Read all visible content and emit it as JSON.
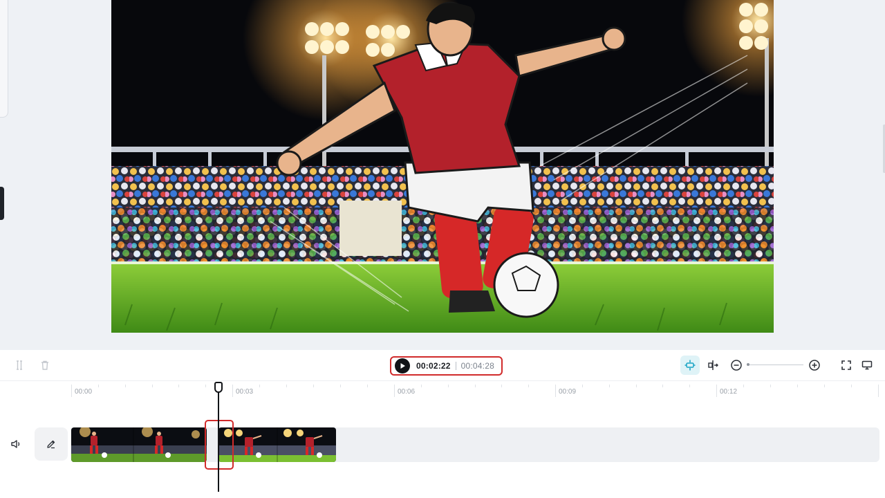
{
  "player": {
    "current_time": "00:02:22",
    "total_time": "00:04:28"
  },
  "toolbar": {
    "left_icons": [
      "split-icon",
      "trash-icon"
    ],
    "right_icons": [
      "auto-snap-icon",
      "split-align-icon",
      "zoom-out-icon",
      "zoom-in-icon",
      "fullscreen-icon",
      "monitor-icon"
    ],
    "zoom_level": 0.0
  },
  "timeline": {
    "ruler_labels": [
      "00:00",
      "00:03",
      "00:06",
      "00:09",
      "00:12"
    ],
    "playhead_time": "00:02:22",
    "track": {
      "icons": [
        "speaker-icon",
        "pencil-icon"
      ],
      "clips": [
        {
          "name": "clip-1"
        },
        {
          "name": "clip-2"
        }
      ]
    }
  },
  "colors": {
    "accent_highlight": "#d12b2b",
    "snap_active_bg": "#dff3f7",
    "snap_active_icon": "#17a3c4",
    "canvas_bg": "#eef1f5"
  }
}
